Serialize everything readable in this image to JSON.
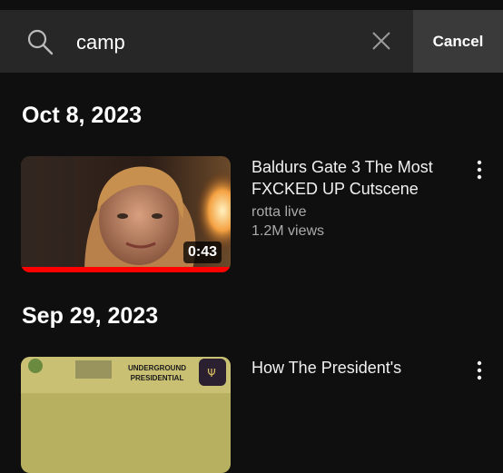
{
  "search": {
    "value": "camp",
    "cancel_label": "Cancel",
    "icons": [
      "search-icon",
      "clear-icon"
    ]
  },
  "sections": [
    {
      "date": "Oct 8, 2023",
      "videos": [
        {
          "title": "Baldurs Gate 3 The Most FXCKED UP Cutscene",
          "channel": "rotta live",
          "views": "1.2M views",
          "duration": "0:43",
          "watched_fraction": 1.0
        }
      ]
    },
    {
      "date": "Sep 29, 2023",
      "videos": [
        {
          "title": "How The President's",
          "thumb_text_line1": "UNDERGROUND",
          "thumb_text_line2": "PRESIDENTIAL"
        }
      ]
    }
  ],
  "colors": {
    "background": "#0f0f0f",
    "search_bar": "#272727",
    "cancel_bg": "#3a3a3a",
    "progress": "#ff0000",
    "secondary_text": "#aaaaaa"
  }
}
